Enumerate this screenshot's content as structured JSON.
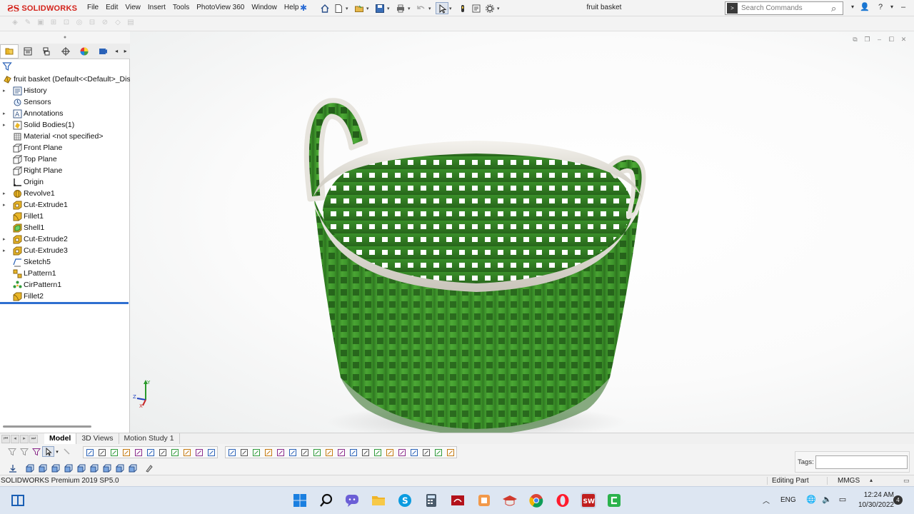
{
  "app": {
    "brand": "SOLIDWORKS",
    "document_title": "fruit basket",
    "menu": [
      "File",
      "Edit",
      "View",
      "Insert",
      "Tools",
      "PhotoView 360",
      "Window",
      "Help"
    ],
    "search_placeholder": "Search Commands",
    "help_label": "?"
  },
  "feature_tree": {
    "root_label": "fruit basket  (Default<<Default>_Dis",
    "items": [
      {
        "label": "History",
        "icon": "history-icon",
        "expandable": true
      },
      {
        "label": "Sensors",
        "icon": "sensors-icon",
        "expandable": false
      },
      {
        "label": "Annotations",
        "icon": "annotations-icon",
        "expandable": true
      },
      {
        "label": "Solid Bodies(1)",
        "icon": "solid-bodies-icon",
        "expandable": true
      },
      {
        "label": "Material <not specified>",
        "icon": "material-icon",
        "expandable": false
      },
      {
        "label": "Front Plane",
        "icon": "plane-icon",
        "expandable": false
      },
      {
        "label": "Top Plane",
        "icon": "plane-icon",
        "expandable": false
      },
      {
        "label": "Right Plane",
        "icon": "plane-icon",
        "expandable": false
      },
      {
        "label": "Origin",
        "icon": "origin-icon",
        "expandable": false
      },
      {
        "label": "Revolve1",
        "icon": "revolve-icon",
        "expandable": true
      },
      {
        "label": "Cut-Extrude1",
        "icon": "cut-extrude-icon",
        "expandable": true
      },
      {
        "label": "Fillet1",
        "icon": "fillet-icon",
        "expandable": false
      },
      {
        "label": "Shell1",
        "icon": "shell-icon",
        "expandable": false
      },
      {
        "label": "Cut-Extrude2",
        "icon": "cut-extrude-icon",
        "expandable": true
      },
      {
        "label": "Cut-Extrude3",
        "icon": "cut-extrude-icon",
        "expandable": true
      },
      {
        "label": "Sketch5",
        "icon": "sketch-icon",
        "expandable": false
      },
      {
        "label": "LPattern1",
        "icon": "linear-pattern-icon",
        "expandable": false
      },
      {
        "label": "CirPattern1",
        "icon": "circular-pattern-icon",
        "expandable": false
      },
      {
        "label": "Fillet2",
        "icon": "fillet-icon",
        "expandable": false
      }
    ]
  },
  "bottom_tabs": [
    "Model",
    "3D Views",
    "Motion Study 1"
  ],
  "active_tab": "Model",
  "tags_label": "Tags:",
  "status": {
    "product": "SOLIDWORKS Premium 2019 SP5.0",
    "mode": "Editing Part",
    "units": "MMGS"
  },
  "taskbar": {
    "language": "ENG",
    "time": "12:24 AM",
    "date": "10/30/2022",
    "notifications": "4"
  },
  "colors": {
    "brand_red": "#d4231b",
    "basket_green": "#3f9a2c",
    "rim": "#e6e3dc",
    "rollback_bar": "#2f6fd0"
  }
}
